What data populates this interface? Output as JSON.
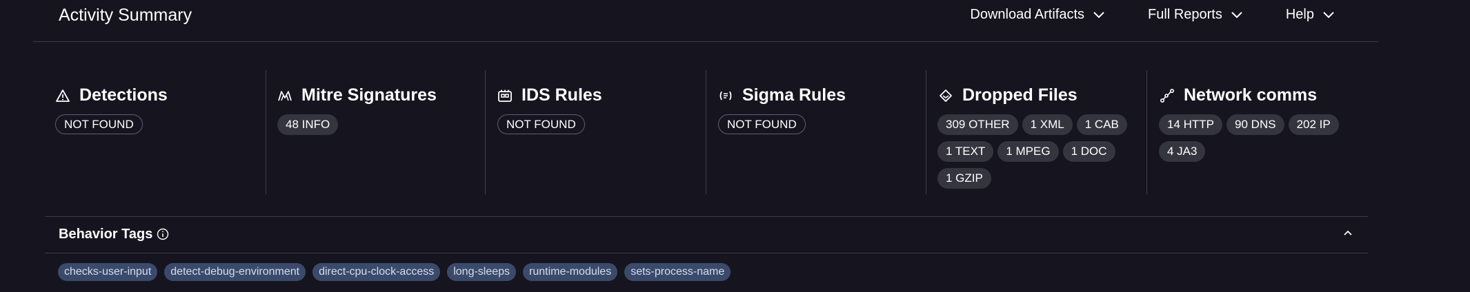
{
  "header": {
    "title": "Activity Summary",
    "menus": [
      {
        "label": "Download Artifacts",
        "icon": "chevron-down-icon"
      },
      {
        "label": "Full Reports",
        "icon": "chevron-down-icon"
      },
      {
        "label": "Help",
        "icon": "chevron-down-icon"
      }
    ]
  },
  "sections": [
    {
      "title": "Detections",
      "icon": "warning-triangle-icon",
      "pills": [
        "NOT FOUND"
      ]
    },
    {
      "title": "Mitre Signatures",
      "icon": "mitre-icon",
      "pills": [
        "48 INFO"
      ]
    },
    {
      "title": "IDS Rules",
      "icon": "ids-rules-icon",
      "pills": [
        "NOT FOUND"
      ]
    },
    {
      "title": "Sigma Rules",
      "icon": "sigma-rules-icon",
      "pills": [
        "NOT FOUND"
      ]
    },
    {
      "title": "Dropped Files",
      "icon": "dropped-files-icon",
      "pills": [
        "309 OTHER",
        "1 XML",
        "1 CAB",
        "1 TEXT",
        "1 MPEG",
        "1 DOC",
        "1 GZIP"
      ]
    },
    {
      "title": "Network comms",
      "icon": "network-icon",
      "pills": [
        "14 HTTP",
        "90 DNS",
        "202 IP",
        "4 JA3"
      ]
    }
  ],
  "behavior": {
    "title": "Behavior Tags",
    "info_icon": "info-icon",
    "collapse_icon": "chevron-up-icon",
    "tags": [
      "checks-user-input",
      "detect-debug-environment",
      "direct-cpu-clock-access",
      "long-sleeps",
      "runtime-modules",
      "sets-process-name"
    ]
  },
  "colors": {
    "background": "#16151f",
    "pill": "#35353f",
    "tag": "#3b4a6b",
    "divider": "#3a3a4e"
  }
}
